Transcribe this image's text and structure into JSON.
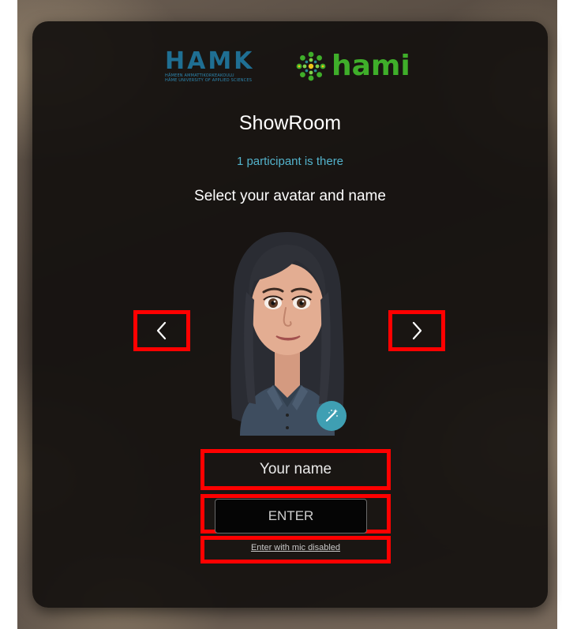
{
  "logos": {
    "hamk": {
      "word": "HAMK",
      "line1": "HÄMEEN AMMATTIKORKEAKOULU",
      "line2": "HÄME UNIVERSITY OF APPLIED SCIENCES",
      "color": "#1f6f93"
    },
    "hami": {
      "word": "hami",
      "color": "#3fae2a"
    }
  },
  "room": {
    "title": "ShowRoom",
    "participants": "1 participant is there",
    "instruction": "Select your avatar and name"
  },
  "avatar_picker": {
    "prev_icon": "chevron-left-icon",
    "next_icon": "chevron-right-icon",
    "edit_icon": "magic-wand-icon"
  },
  "name_field": {
    "placeholder": "Your name",
    "value": ""
  },
  "actions": {
    "enter_label": "ENTER",
    "mic_disabled_label": "Enter with mic disabled"
  },
  "colors": {
    "accent": "#53b3cc",
    "highlight_border": "#ff0000",
    "panel": "#14110f",
    "edit_button": "#3f9fb3"
  }
}
